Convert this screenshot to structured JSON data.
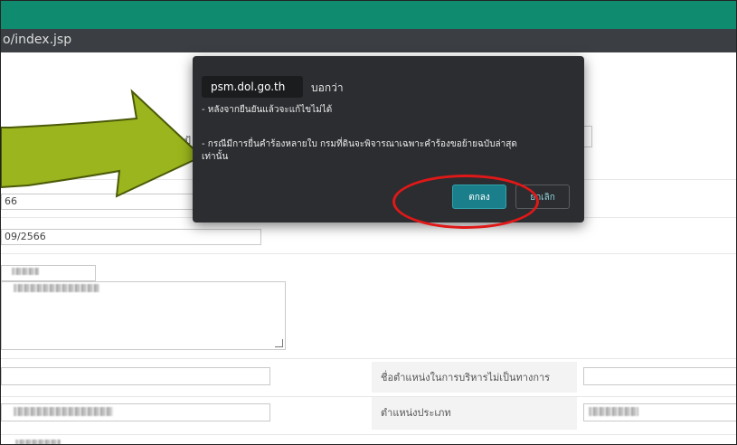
{
  "browser": {
    "url_fragment": "o/index.jsp"
  },
  "dialog": {
    "site": "psm.dol.go.th",
    "says": "บอกว่า",
    "line1": "- หลังจากยืนยันแล้วจะแก้ไขไม่ได้",
    "line2a": "- กรณีมีการยื่นคำร้องหลายใบ กรมที่ดินจะพิจารณาเฉพาะคำร้องขอย้ายฉบับล่าสุด",
    "line2b": "เท่านั้น",
    "ok_label": "ตกลง",
    "cancel_label": "ยกเลิก"
  },
  "form": {
    "partial_label": "ป้",
    "field1_value": "66",
    "field2_value": "09/2566",
    "label_admin_position": "ชื่อตำแหน่งในการบริหารไม่เป็นทางการ",
    "label_position_type": "ตำแหน่งประเภท"
  },
  "colors": {
    "header_green": "#0f8c6f",
    "dialog_bg": "#2b2d30",
    "ok_button": "#1a7f8a",
    "annotation_red": "#e01818",
    "annotation_arrow": "#9ab51d"
  }
}
